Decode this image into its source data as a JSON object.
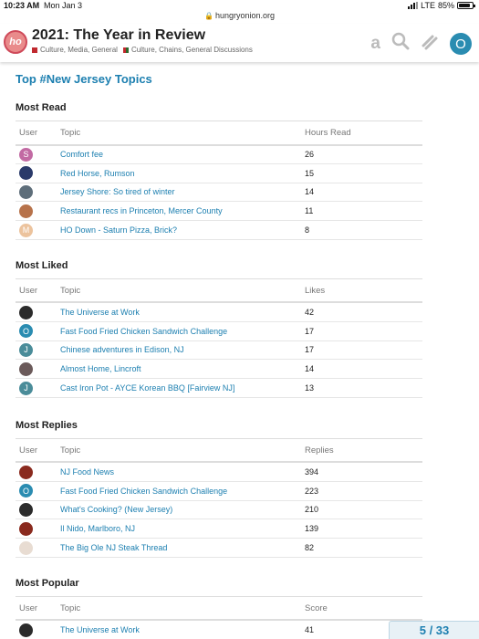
{
  "status_bar": {
    "time": "10:23 AM",
    "date": "Mon Jan 3",
    "network": "LTE",
    "battery": "85%",
    "battery_level": 0.85
  },
  "browser": {
    "url": "hungryonion.org"
  },
  "header": {
    "title": "2021: The Year in Review",
    "categories": [
      {
        "label": "Culture, Media, General",
        "color": "#c0292f"
      },
      {
        "label": "Culture, Chains, General Discussions",
        "color": "#c0292f",
        "color2": "#2d6a2d"
      }
    ],
    "user_avatar_letter": "O",
    "icons": [
      "amazon-icon",
      "search-icon",
      "hamburger-icon",
      "user-avatar"
    ]
  },
  "page_heading": "Top #New Jersey Topics",
  "sections": [
    {
      "title": "Most Read",
      "columns": [
        "User",
        "Topic",
        "Hours Read"
      ],
      "rows": [
        {
          "avatar": {
            "letter": "S",
            "color": "#c26aa3"
          },
          "topic": "Comfort fee",
          "value": "26"
        },
        {
          "avatar": {
            "letter": "",
            "color": "#2a3a6a"
          },
          "topic": "Red Horse, Rumson",
          "value": "15"
        },
        {
          "avatar": {
            "letter": "",
            "color": "#5e6e7a"
          },
          "topic": "Jersey Shore: So tired of winter",
          "value": "14"
        },
        {
          "avatar": {
            "letter": "",
            "color": "#b7724a"
          },
          "topic": "Restaurant recs in Princeton, Mercer County",
          "value": "11"
        },
        {
          "avatar": {
            "letter": "M",
            "color": "#ecc39d"
          },
          "topic": "HO Down - Saturn Pizza, Brick?",
          "value": "8"
        }
      ]
    },
    {
      "title": "Most Liked",
      "columns": [
        "User",
        "Topic",
        "Likes"
      ],
      "rows": [
        {
          "avatar": {
            "letter": "",
            "color": "#2b2b2b"
          },
          "topic": "The Universe at Work",
          "value": "42"
        },
        {
          "avatar": {
            "letter": "O",
            "color": "#2a8cb1"
          },
          "topic": "Fast Food Fried Chicken Sandwich Challenge",
          "value": "17"
        },
        {
          "avatar": {
            "letter": "J",
            "color": "#4a8c99"
          },
          "topic": "Chinese adventures in Edison, NJ",
          "value": "17"
        },
        {
          "avatar": {
            "letter": "",
            "color": "#6b5a5a"
          },
          "topic": "Almost Home, Lincroft",
          "value": "14"
        },
        {
          "avatar": {
            "letter": "J",
            "color": "#4a8c99"
          },
          "topic": "Cast Iron Pot - AYCE Korean BBQ [Fairview NJ]",
          "value": "13"
        }
      ]
    },
    {
      "title": "Most Replies",
      "columns": [
        "User",
        "Topic",
        "Replies"
      ],
      "rows": [
        {
          "avatar": {
            "letter": "",
            "color": "#8a2a1e"
          },
          "topic": "NJ Food News",
          "value": "394"
        },
        {
          "avatar": {
            "letter": "O",
            "color": "#2a8cb1"
          },
          "topic": "Fast Food Fried Chicken Sandwich Challenge",
          "value": "223"
        },
        {
          "avatar": {
            "letter": "",
            "color": "#2b2b2b"
          },
          "topic": "What's Cooking? (New Jersey)",
          "value": "210"
        },
        {
          "avatar": {
            "letter": "",
            "color": "#8a2a1e"
          },
          "topic": "Il Nido, Marlboro, NJ",
          "value": "139"
        },
        {
          "avatar": {
            "letter": "",
            "color": "#e8dcd2"
          },
          "topic": "The Big Ole NJ Steak Thread",
          "value": "82"
        }
      ]
    },
    {
      "title": "Most Popular",
      "columns": [
        "User",
        "Topic",
        "Score"
      ],
      "rows": [
        {
          "avatar": {
            "letter": "",
            "color": "#2b2b2b"
          },
          "topic": "The Universe at Work",
          "value": "41"
        }
      ]
    }
  ],
  "progress": {
    "label": "5 / 33"
  }
}
